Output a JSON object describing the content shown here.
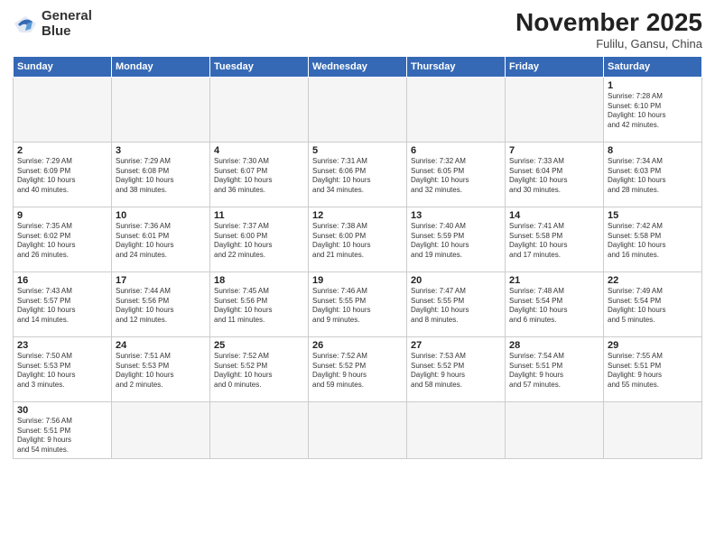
{
  "logo": {
    "line1": "General",
    "line2": "Blue"
  },
  "title": "November 2025",
  "location": "Fulilu, Gansu, China",
  "days_header": [
    "Sunday",
    "Monday",
    "Tuesday",
    "Wednesday",
    "Thursday",
    "Friday",
    "Saturday"
  ],
  "weeks": [
    [
      {
        "num": "",
        "info": ""
      },
      {
        "num": "",
        "info": ""
      },
      {
        "num": "",
        "info": ""
      },
      {
        "num": "",
        "info": ""
      },
      {
        "num": "",
        "info": ""
      },
      {
        "num": "",
        "info": ""
      },
      {
        "num": "1",
        "info": "Sunrise: 7:28 AM\nSunset: 6:10 PM\nDaylight: 10 hours\nand 42 minutes."
      }
    ],
    [
      {
        "num": "2",
        "info": "Sunrise: 7:29 AM\nSunset: 6:09 PM\nDaylight: 10 hours\nand 40 minutes."
      },
      {
        "num": "3",
        "info": "Sunrise: 7:29 AM\nSunset: 6:08 PM\nDaylight: 10 hours\nand 38 minutes."
      },
      {
        "num": "4",
        "info": "Sunrise: 7:30 AM\nSunset: 6:07 PM\nDaylight: 10 hours\nand 36 minutes."
      },
      {
        "num": "5",
        "info": "Sunrise: 7:31 AM\nSunset: 6:06 PM\nDaylight: 10 hours\nand 34 minutes."
      },
      {
        "num": "6",
        "info": "Sunrise: 7:32 AM\nSunset: 6:05 PM\nDaylight: 10 hours\nand 32 minutes."
      },
      {
        "num": "7",
        "info": "Sunrise: 7:33 AM\nSunset: 6:04 PM\nDaylight: 10 hours\nand 30 minutes."
      },
      {
        "num": "8",
        "info": "Sunrise: 7:34 AM\nSunset: 6:03 PM\nDaylight: 10 hours\nand 28 minutes."
      }
    ],
    [
      {
        "num": "9",
        "info": "Sunrise: 7:35 AM\nSunset: 6:02 PM\nDaylight: 10 hours\nand 26 minutes."
      },
      {
        "num": "10",
        "info": "Sunrise: 7:36 AM\nSunset: 6:01 PM\nDaylight: 10 hours\nand 24 minutes."
      },
      {
        "num": "11",
        "info": "Sunrise: 7:37 AM\nSunset: 6:00 PM\nDaylight: 10 hours\nand 22 minutes."
      },
      {
        "num": "12",
        "info": "Sunrise: 7:38 AM\nSunset: 6:00 PM\nDaylight: 10 hours\nand 21 minutes."
      },
      {
        "num": "13",
        "info": "Sunrise: 7:40 AM\nSunset: 5:59 PM\nDaylight: 10 hours\nand 19 minutes."
      },
      {
        "num": "14",
        "info": "Sunrise: 7:41 AM\nSunset: 5:58 PM\nDaylight: 10 hours\nand 17 minutes."
      },
      {
        "num": "15",
        "info": "Sunrise: 7:42 AM\nSunset: 5:58 PM\nDaylight: 10 hours\nand 16 minutes."
      }
    ],
    [
      {
        "num": "16",
        "info": "Sunrise: 7:43 AM\nSunset: 5:57 PM\nDaylight: 10 hours\nand 14 minutes."
      },
      {
        "num": "17",
        "info": "Sunrise: 7:44 AM\nSunset: 5:56 PM\nDaylight: 10 hours\nand 12 minutes."
      },
      {
        "num": "18",
        "info": "Sunrise: 7:45 AM\nSunset: 5:56 PM\nDaylight: 10 hours\nand 11 minutes."
      },
      {
        "num": "19",
        "info": "Sunrise: 7:46 AM\nSunset: 5:55 PM\nDaylight: 10 hours\nand 9 minutes."
      },
      {
        "num": "20",
        "info": "Sunrise: 7:47 AM\nSunset: 5:55 PM\nDaylight: 10 hours\nand 8 minutes."
      },
      {
        "num": "21",
        "info": "Sunrise: 7:48 AM\nSunset: 5:54 PM\nDaylight: 10 hours\nand 6 minutes."
      },
      {
        "num": "22",
        "info": "Sunrise: 7:49 AM\nSunset: 5:54 PM\nDaylight: 10 hours\nand 5 minutes."
      }
    ],
    [
      {
        "num": "23",
        "info": "Sunrise: 7:50 AM\nSunset: 5:53 PM\nDaylight: 10 hours\nand 3 minutes."
      },
      {
        "num": "24",
        "info": "Sunrise: 7:51 AM\nSunset: 5:53 PM\nDaylight: 10 hours\nand 2 minutes."
      },
      {
        "num": "25",
        "info": "Sunrise: 7:52 AM\nSunset: 5:52 PM\nDaylight: 10 hours\nand 0 minutes."
      },
      {
        "num": "26",
        "info": "Sunrise: 7:52 AM\nSunset: 5:52 PM\nDaylight: 9 hours\nand 59 minutes."
      },
      {
        "num": "27",
        "info": "Sunrise: 7:53 AM\nSunset: 5:52 PM\nDaylight: 9 hours\nand 58 minutes."
      },
      {
        "num": "28",
        "info": "Sunrise: 7:54 AM\nSunset: 5:51 PM\nDaylight: 9 hours\nand 57 minutes."
      },
      {
        "num": "29",
        "info": "Sunrise: 7:55 AM\nSunset: 5:51 PM\nDaylight: 9 hours\nand 55 minutes."
      }
    ],
    [
      {
        "num": "30",
        "info": "Sunrise: 7:56 AM\nSunset: 5:51 PM\nDaylight: 9 hours\nand 54 minutes."
      },
      {
        "num": "",
        "info": ""
      },
      {
        "num": "",
        "info": ""
      },
      {
        "num": "",
        "info": ""
      },
      {
        "num": "",
        "info": ""
      },
      {
        "num": "",
        "info": ""
      },
      {
        "num": "",
        "info": ""
      }
    ]
  ]
}
